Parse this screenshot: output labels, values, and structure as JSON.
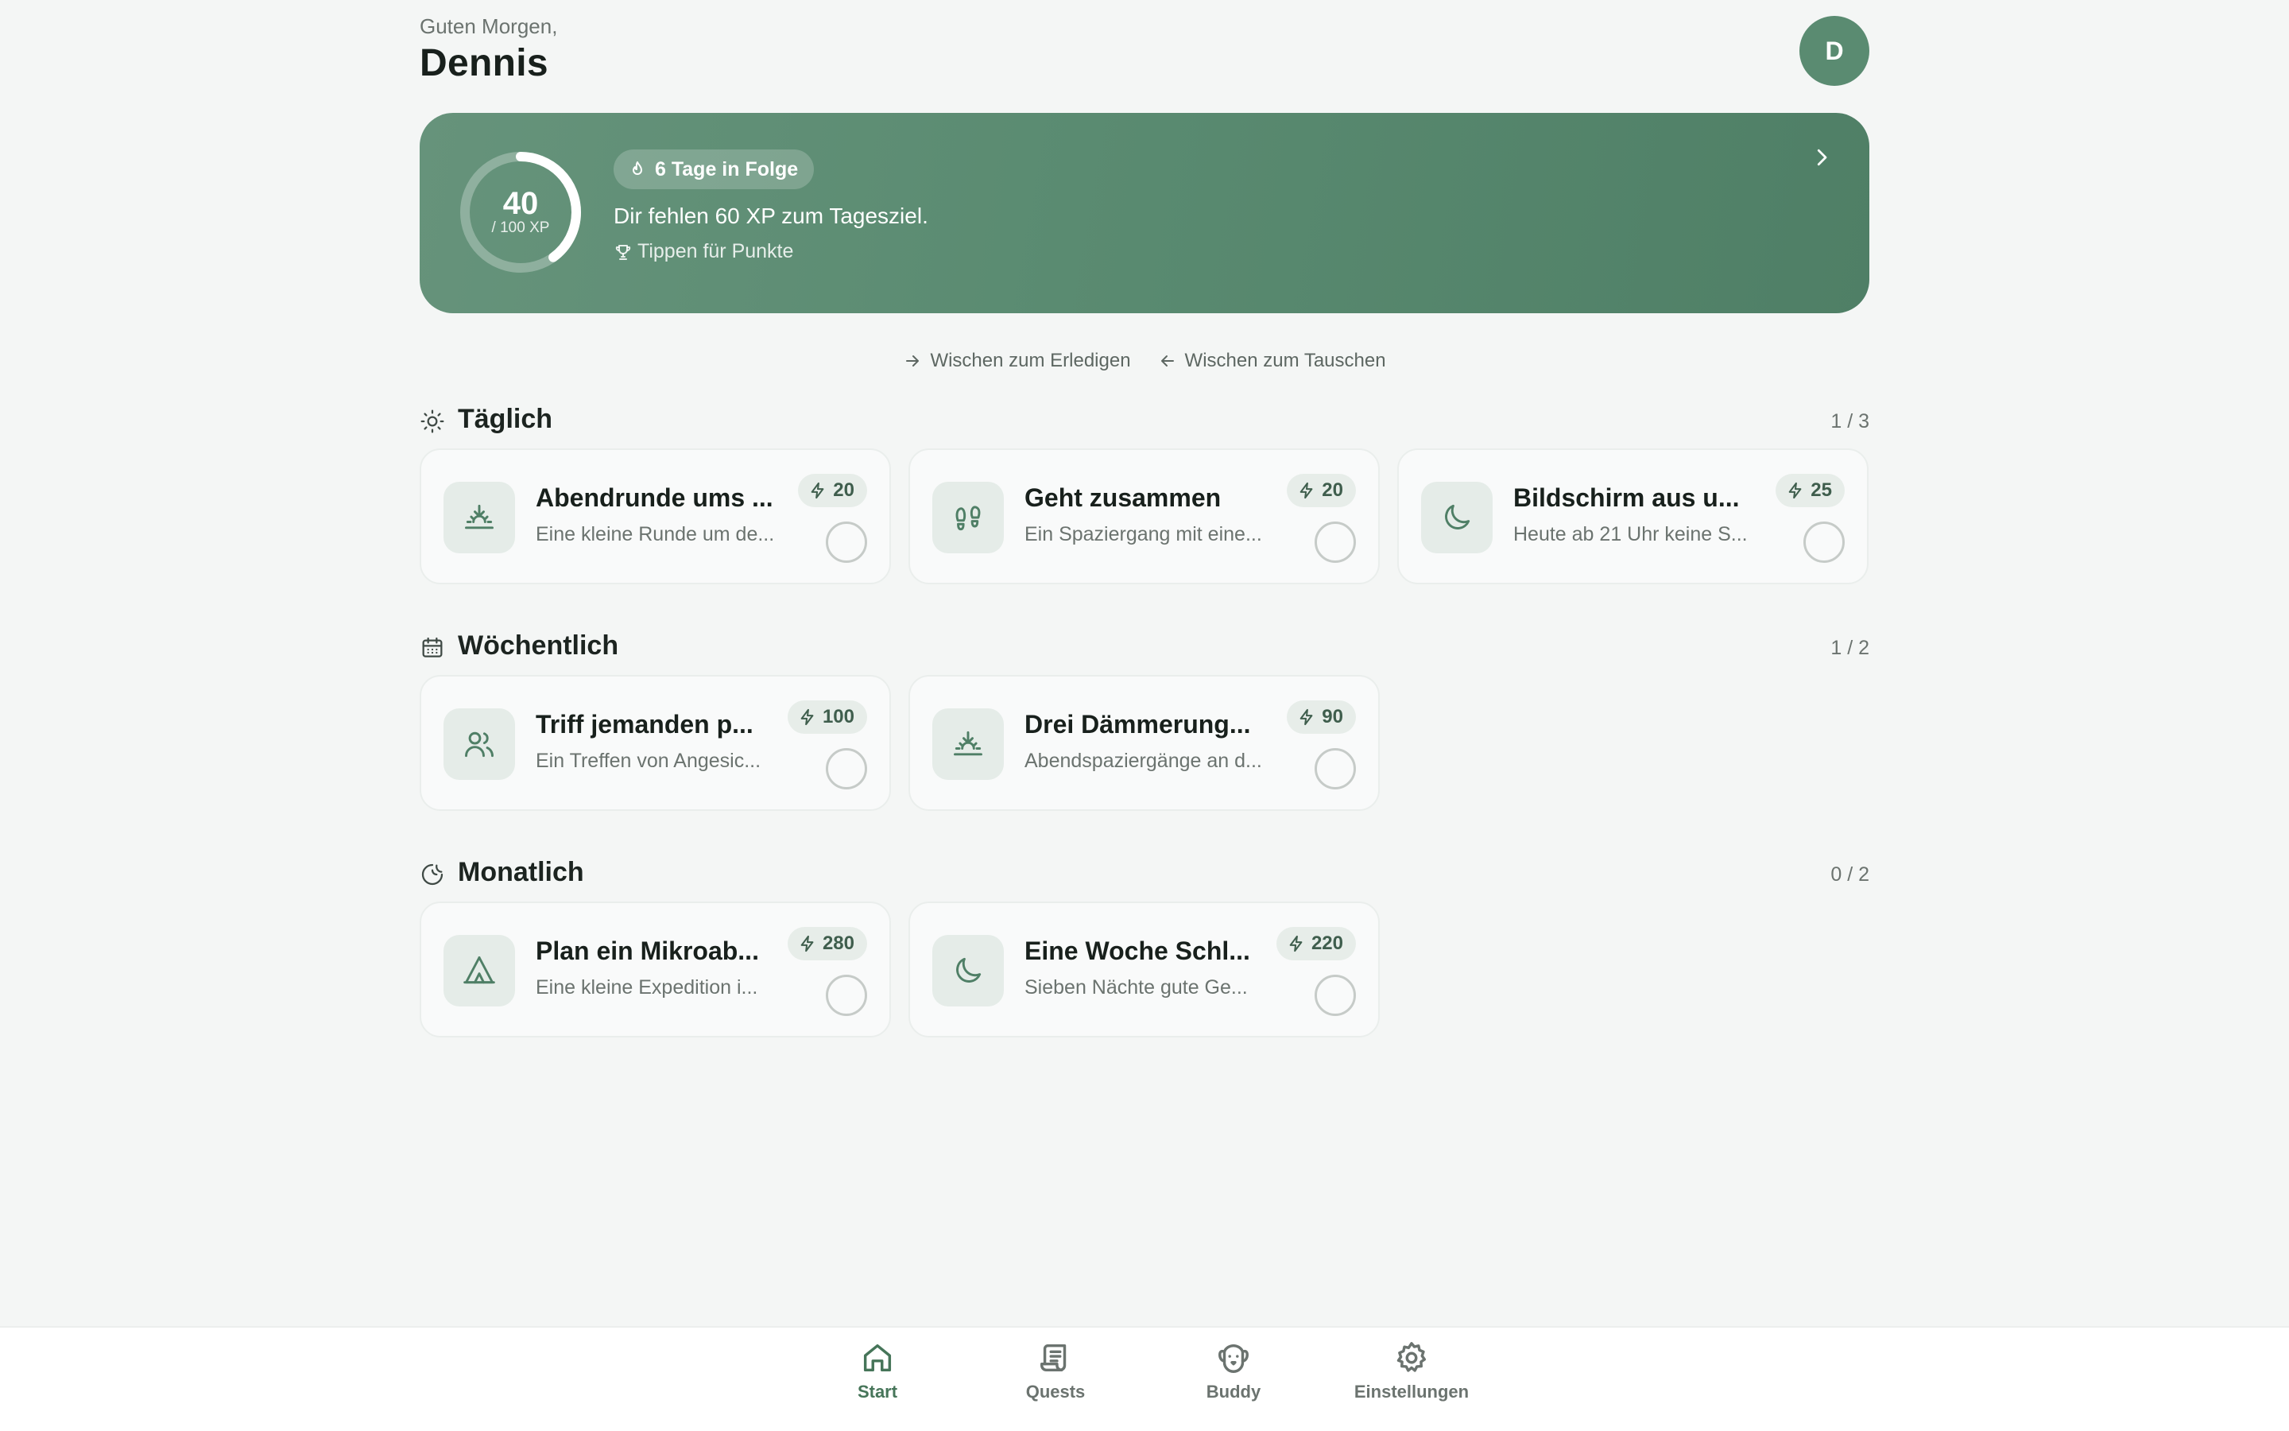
{
  "header": {
    "greeting": "Guten Morgen,",
    "username": "Dennis",
    "avatar_initial": "D"
  },
  "hero": {
    "xp_current": "40",
    "xp_goal_label": "/ 100 XP",
    "progress_fraction": 0.4,
    "streak_label": "6 Tage in Folge",
    "message": "Dir fehlen 60 XP zum Tagesziel.",
    "tips_link": "Tippen für Punkte"
  },
  "hints": {
    "complete": "Wischen zum Erledigen",
    "swap": "Wischen zum Tauschen"
  },
  "sections": {
    "daily": {
      "title": "Täglich",
      "count": "1 / 3",
      "quests": [
        {
          "title": "Abendrunde ums ...",
          "desc": "Eine kleine Runde um de...",
          "xp": "20",
          "icon": "sunset-icon"
        },
        {
          "title": "Geht zusammen",
          "desc": "Ein Spaziergang mit eine...",
          "xp": "20",
          "icon": "footprints-icon"
        },
        {
          "title": "Bildschirm aus u...",
          "desc": "Heute ab 21 Uhr keine S...",
          "xp": "25",
          "icon": "moon-icon"
        }
      ]
    },
    "weekly": {
      "title": "Wöchentlich",
      "count": "1 / 2",
      "quests": [
        {
          "title": "Triff jemanden p...",
          "desc": "Ein Treffen von Angesic...",
          "xp": "100",
          "icon": "users-icon"
        },
        {
          "title": "Drei Dämmerung...",
          "desc": "Abendspaziergänge an d...",
          "xp": "90",
          "icon": "sunset-icon"
        }
      ]
    },
    "monthly": {
      "title": "Monatlich",
      "count": "0 / 2",
      "quests": [
        {
          "title": "Plan ein Mikroab...",
          "desc": "Eine kleine Expedition i...",
          "xp": "280",
          "icon": "tent-icon"
        },
        {
          "title": "Eine Woche Schl...",
          "desc": "Sieben Nächte gute Ge...",
          "xp": "220",
          "icon": "moon-icon"
        }
      ]
    }
  },
  "nav": {
    "start": "Start",
    "quests": "Quests",
    "buddy": "Buddy",
    "settings": "Einstellungen"
  },
  "colors": {
    "accent": "#5a8b71",
    "background": "#f4f6f5",
    "nav_active": "#467559"
  }
}
